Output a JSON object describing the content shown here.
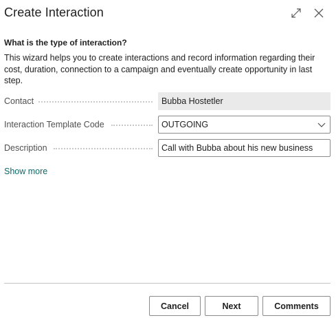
{
  "dialog": {
    "title": "Create Interaction",
    "icons": {
      "expand": "expand-icon",
      "close": "close-icon"
    }
  },
  "step": {
    "heading": "What is the type of interaction?",
    "description": "This wizard helps you to create interactions and record information regarding their cost, duration, connection to a campaign and eventually create opportunity in last step."
  },
  "fields": {
    "contact": {
      "label": "Contact",
      "value": "Bubba Hostetler"
    },
    "template_code": {
      "label": "Interaction Template Code",
      "value": "OUTGOING"
    },
    "description": {
      "label": "Description",
      "value": "Call with Bubba about his new business"
    }
  },
  "links": {
    "show_more": "Show more"
  },
  "footer": {
    "cancel_label": "Cancel",
    "next_label": "Next",
    "comments_label": "Comments"
  },
  "colors": {
    "link": "#0b6a6a",
    "readonly_bg": "#eaeaea",
    "border": "#8a8a8a"
  }
}
